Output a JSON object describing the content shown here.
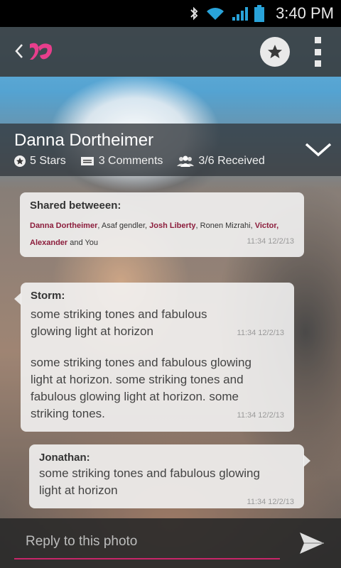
{
  "status_bar": {
    "time": "3:40 PM"
  },
  "post": {
    "author": "Danna Dortheimer",
    "stars_label": "5 Stars",
    "comments_label": "3 Comments",
    "received_label": "3/6 Received"
  },
  "shared": {
    "title": "Shared betweeen:",
    "names": [
      {
        "text": "Danna Dortheimer",
        "highlight": true
      },
      {
        "text": ", Asaf gendler, ",
        "highlight": false
      },
      {
        "text": "Josh Liberty",
        "highlight": true
      },
      {
        "text": ", Ronen Mizrahi, ",
        "highlight": false
      },
      {
        "text": "Victor, Alexander",
        "highlight": true
      },
      {
        "text": " and You",
        "highlight": false
      }
    ],
    "timestamp": "11:34 12/2/13"
  },
  "messages": [
    {
      "sender": "Storm:",
      "parts": [
        {
          "text": "some striking tones and fabulous glowing light at horizon",
          "timestamp": "11:34 12/2/13"
        },
        {
          "text": "some striking tones and fabulous glowing light at horizon. some striking tones and fabulous glowing light at horizon. some striking tones.",
          "timestamp": "11:34 12/2/13"
        }
      ]
    },
    {
      "sender": "Jonathan:",
      "parts": [
        {
          "text": "some striking tones and fabulous glowing light at horizon",
          "timestamp": "11:34 12/2/13"
        }
      ]
    }
  ],
  "reply": {
    "placeholder": "Reply to this photo"
  },
  "colors": {
    "accent": "#c8266a",
    "highlight_name": "#8c1d3c",
    "logo_pink": "#e83e8c"
  }
}
